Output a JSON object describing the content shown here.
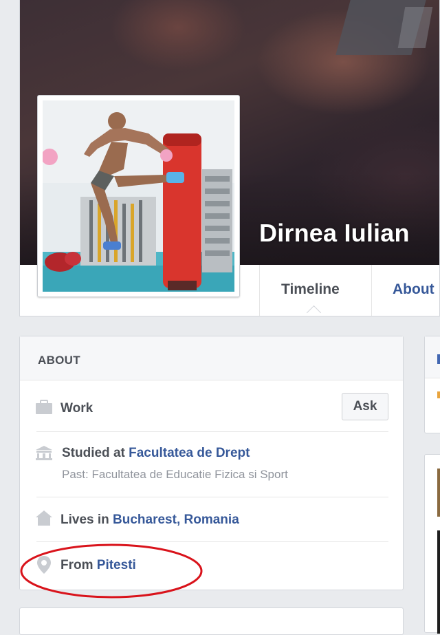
{
  "profile": {
    "name": "Dirnea Iulian"
  },
  "nav": {
    "tabs": [
      {
        "label": "Timeline"
      },
      {
        "label": "About"
      }
    ]
  },
  "about": {
    "heading": "ABOUT",
    "work": {
      "label": "Work",
      "ask_label": "Ask",
      "icon": "briefcase-icon"
    },
    "education": {
      "prefix": "Studied at ",
      "school": "Facultatea de Drept",
      "past": "Past: Facultatea de Educatie Fizica si Sport",
      "icon": "school-icon"
    },
    "residence": {
      "prefix": "Lives in ",
      "city": "Bucharest",
      "separator": ", ",
      "country": "Romania",
      "icon": "home-icon"
    },
    "origin": {
      "prefix": "From ",
      "city": "Pitesti",
      "icon": "location-pin-icon"
    }
  },
  "annotation": {
    "color": "#d9131b",
    "shape": "ellipse"
  },
  "colors": {
    "link": "#365899",
    "text": "#4b4f56",
    "muted": "#90949c",
    "page_bg": "#e9ebee"
  }
}
